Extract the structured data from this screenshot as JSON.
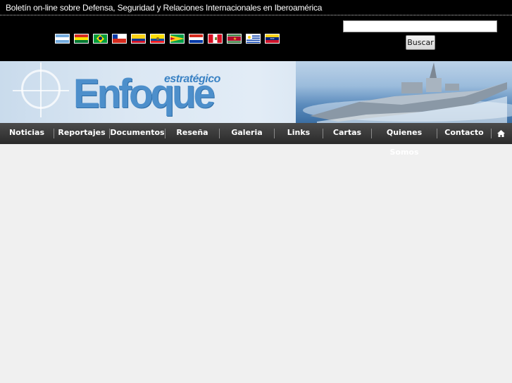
{
  "header": {
    "tagline": "Boletín on-line sobre Defensa, Seguridad y Relaciones Internacionales en Iberoamérica"
  },
  "flags": [
    {
      "country": "Argentina",
      "icon": "argentina-flag-icon"
    },
    {
      "country": "Bolivia",
      "icon": "bolivia-flag-icon"
    },
    {
      "country": "Brasil",
      "icon": "brazil-flag-icon"
    },
    {
      "country": "Chile",
      "icon": "chile-flag-icon"
    },
    {
      "country": "Colombia",
      "icon": "colombia-flag-icon"
    },
    {
      "country": "Ecuador",
      "icon": "ecuador-flag-icon"
    },
    {
      "country": "Guyana",
      "icon": "guyana-flag-icon"
    },
    {
      "country": "Paraguay",
      "icon": "paraguay-flag-icon"
    },
    {
      "country": "Perú",
      "icon": "peru-flag-icon"
    },
    {
      "country": "Surinam",
      "icon": "suriname-flag-icon"
    },
    {
      "country": "Uruguay",
      "icon": "uruguay-flag-icon"
    },
    {
      "country": "Venezuela",
      "icon": "venezuela-flag-icon"
    }
  ],
  "search": {
    "value": "",
    "button_label": "Buscar"
  },
  "logo": {
    "small": "estratégico",
    "big": "Enfoque"
  },
  "nav": {
    "items": [
      "Noticias",
      "Reportajes",
      "Documentos",
      "Reseña",
      "Galeria",
      "Links",
      "Cartas",
      "Quienes Somos",
      "Contacto"
    ],
    "home_icon": "home-icon"
  }
}
